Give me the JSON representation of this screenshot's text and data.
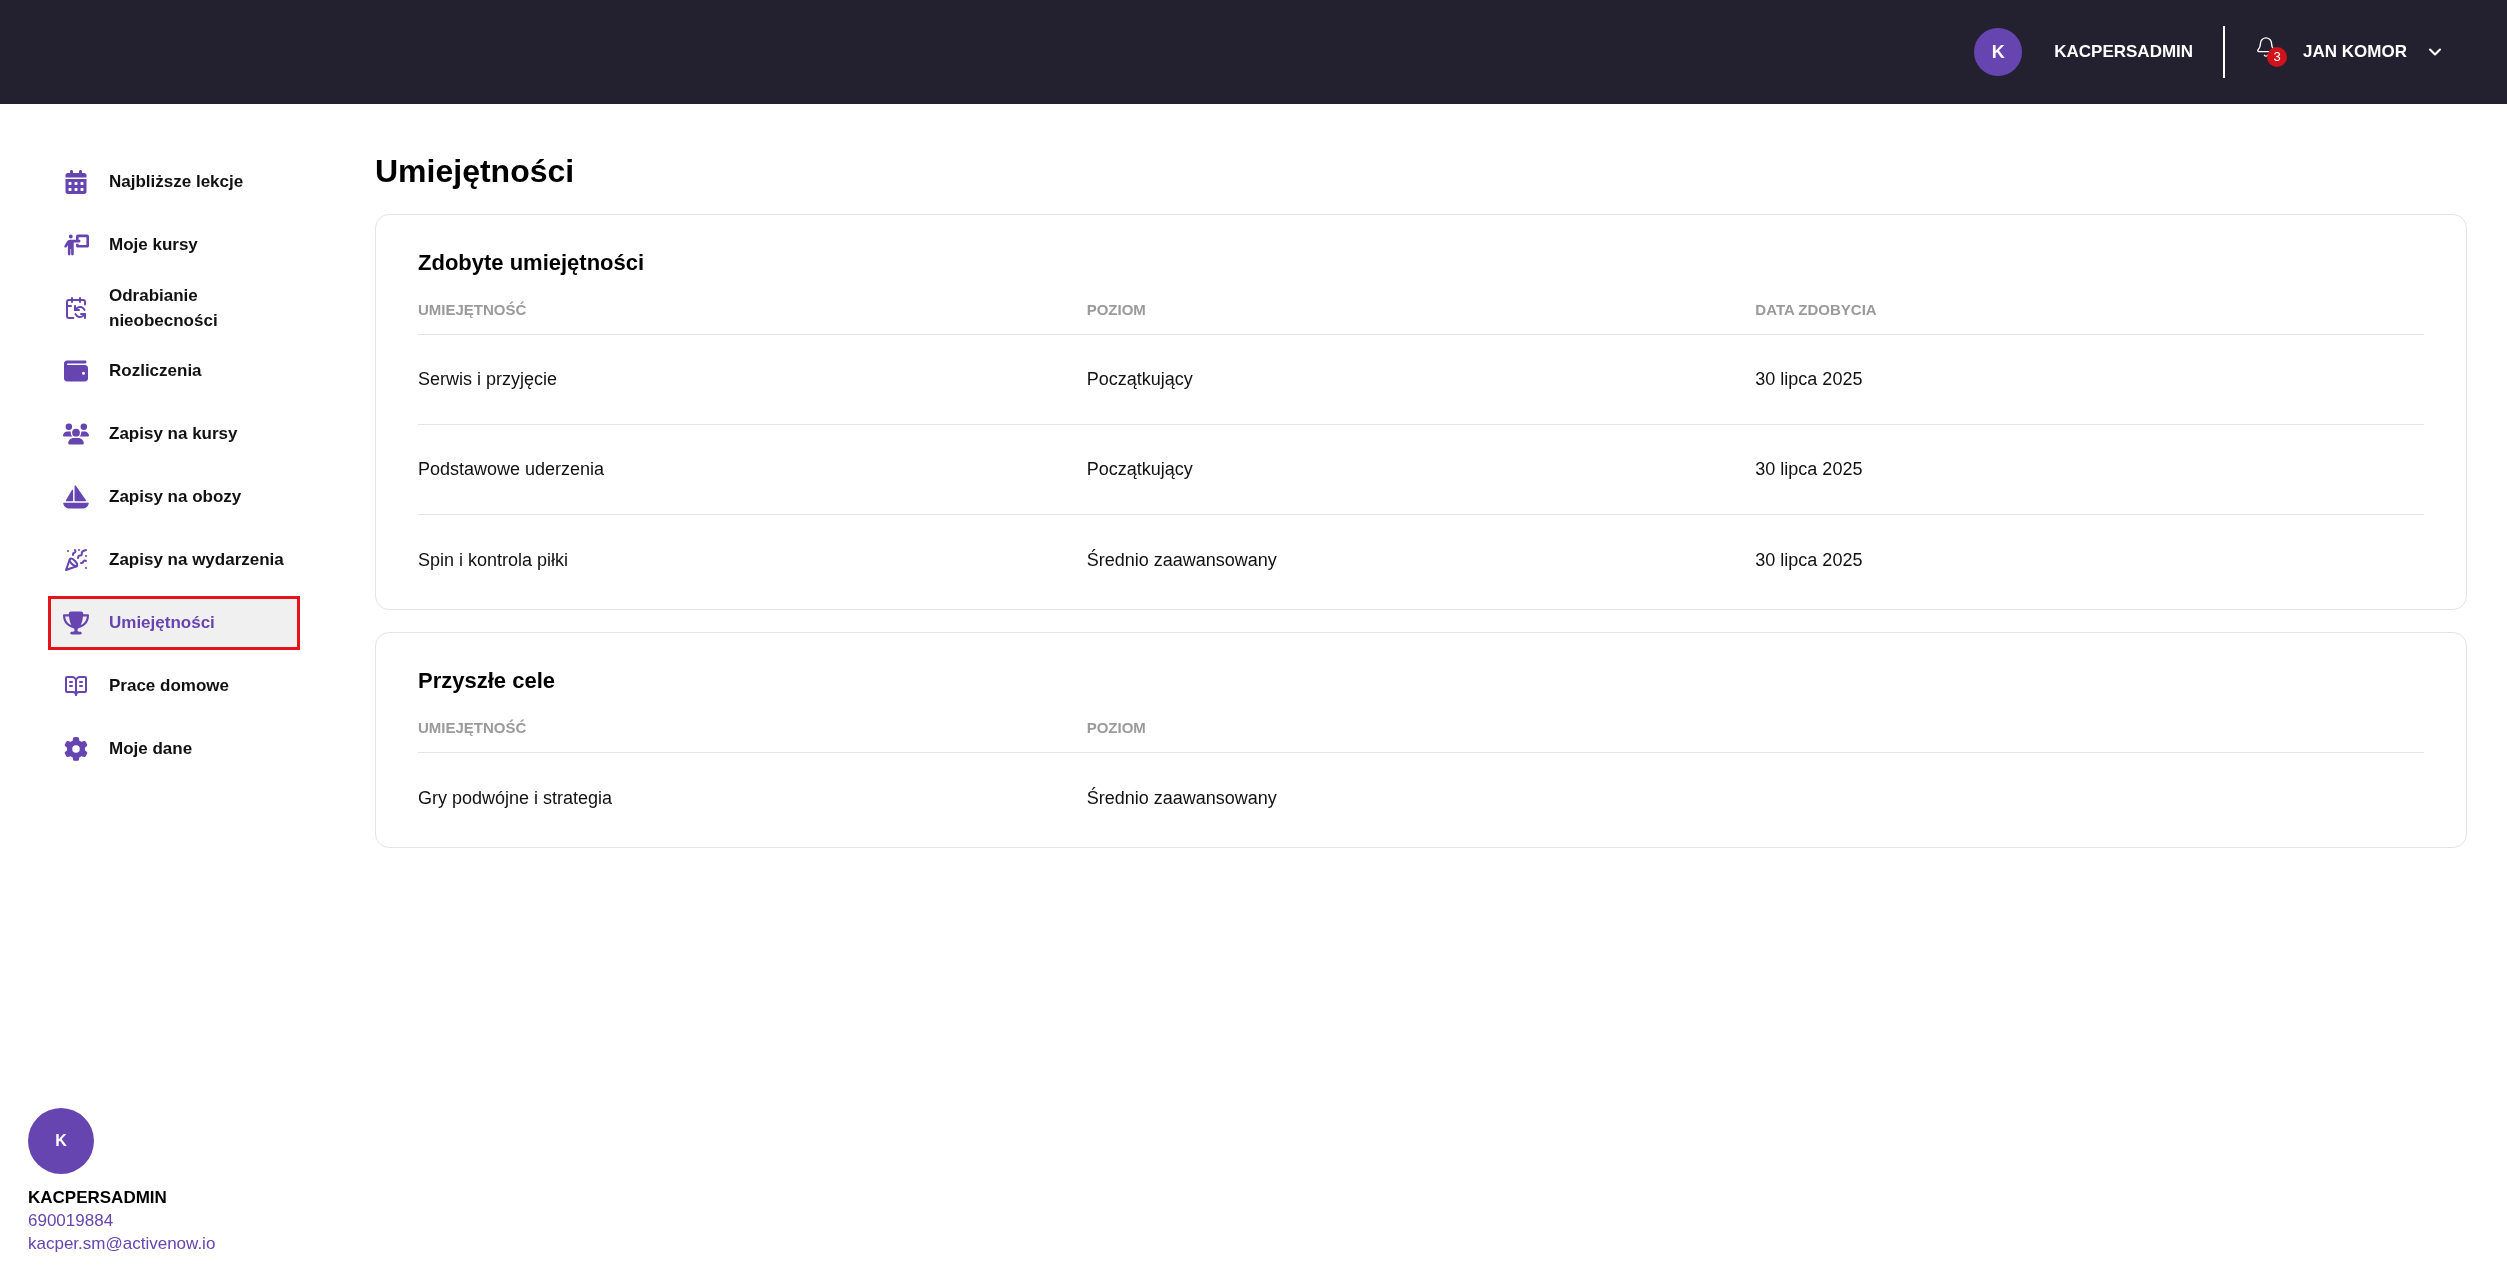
{
  "top_bar": {
    "user_avatar": "K",
    "user_name": "KACPERSADMIN",
    "notifications_count": "3",
    "account_name": "JAN KOMOR"
  },
  "sidebar": {
    "items": [
      {
        "label": "Najbliższe lekcje",
        "selected": false
      },
      {
        "label": "Moje kursy",
        "selected": false
      },
      {
        "label": "Odrabianie nieobecności",
        "selected": false
      },
      {
        "label": "Rozliczenia",
        "selected": false
      },
      {
        "label": "Zapisy na kursy",
        "selected": false
      },
      {
        "label": "Zapisy na obozy",
        "selected": false
      },
      {
        "label": "Zapisy na wydarzenia",
        "selected": false
      },
      {
        "label": "Umiejętności",
        "selected": true
      },
      {
        "label": "Prace domowe",
        "selected": false
      },
      {
        "label": "Moje dane",
        "selected": false
      }
    ],
    "profile": {
      "avatar": "K",
      "name": "KACPERSADMIN",
      "phone": "690019884",
      "email": "kacper.sm@activenow.io"
    }
  },
  "page_title": "Umiejętności",
  "cards": [
    {
      "title": "Zdobyte umiejętności",
      "columns": [
        "UMIEJĘTNOŚĆ",
        "POZIOM",
        "DATA ZDOBYCIA"
      ],
      "rows": [
        [
          "Serwis i przyjęcie",
          "Początkujący",
          "30 lipca 2025"
        ],
        [
          "Podstawowe uderzenia",
          "Początkujący",
          "30 lipca 2025"
        ],
        [
          "Spin i kontrola piłki",
          "Średnio zaawansowany",
          "30 lipca 2025"
        ]
      ]
    },
    {
      "title": "Przyszłe cele",
      "columns": [
        "UMIEJĘTNOŚĆ",
        "POZIOM"
      ],
      "rows": [
        [
          "Gry podwójne i strategia",
          "Średnio zaawansowany"
        ]
      ]
    }
  ]
}
